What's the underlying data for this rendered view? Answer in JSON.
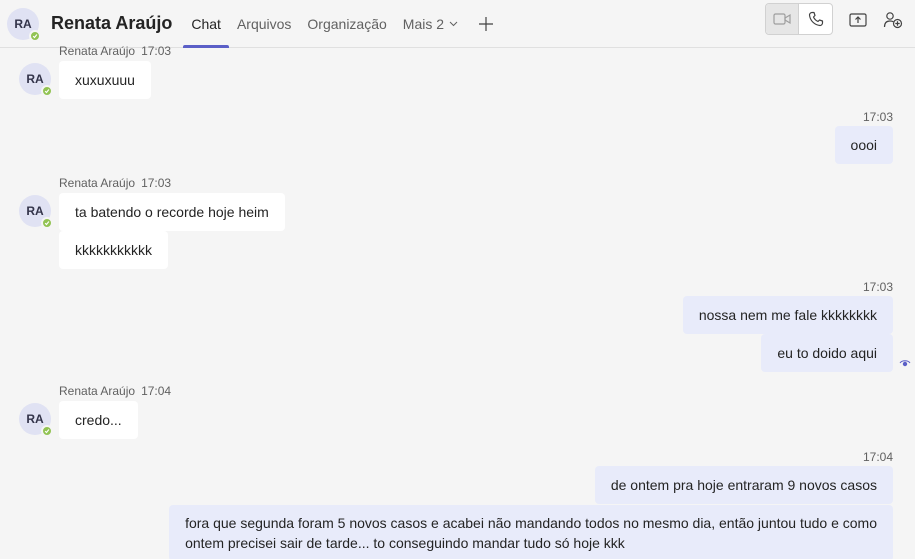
{
  "header": {
    "avatar_initials": "RA",
    "name": "Renata Araújo",
    "tabs": [
      {
        "label": "Chat",
        "active": true
      },
      {
        "label": "Arquivos"
      },
      {
        "label": "Organização"
      },
      {
        "label": "Mais 2"
      }
    ],
    "icons": [
      "plus-icon",
      "video-call-icon",
      "phone-call-icon",
      "share-screen-icon",
      "add-people-icon"
    ]
  },
  "colors": {
    "accent": "#5b5fc7",
    "presence_available": "#92c353",
    "outgoing_bubble": "#e8ebfa",
    "incoming_bubble": "#ffffff"
  },
  "messages": [
    {
      "direction": "in",
      "sender": "Renata Araújo",
      "time": "17:03",
      "texts": [
        "xuxuxuuu"
      ]
    },
    {
      "direction": "out",
      "time": "17:03",
      "texts": [
        "oooi"
      ]
    },
    {
      "direction": "in",
      "sender": "Renata Araújo",
      "time": "17:03",
      "texts": [
        "ta batendo o recorde hoje heim",
        "kkkkkkkkkkk"
      ]
    },
    {
      "direction": "out",
      "time": "17:03",
      "texts": [
        "nossa nem me fale kkkkkkkk",
        "eu to doido aqui"
      ]
    },
    {
      "direction": "in",
      "sender": "Renata Araújo",
      "time": "17:04",
      "texts": [
        "credo..."
      ]
    },
    {
      "direction": "out",
      "time": "17:04",
      "texts": [
        "de ontem pra hoje entraram 9 novos casos",
        "fora que segunda foram 5 novos casos e acabei não mandando todos no mesmo dia, então juntou tudo e como",
        "ontem precisei sair de tarde... to conseguindo mandar tudo só hoje kkk"
      ]
    }
  ]
}
